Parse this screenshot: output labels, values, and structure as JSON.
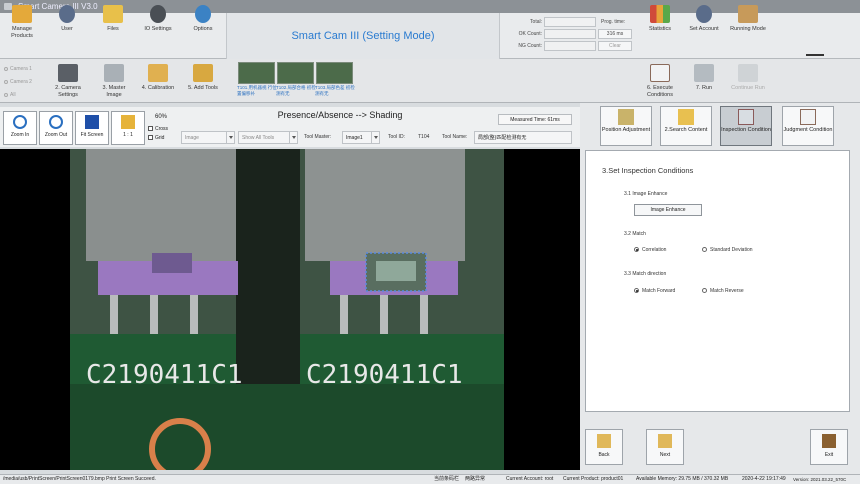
{
  "window": {
    "title": "Smart Camera III V3.0"
  },
  "ribbon": {
    "buttons": [
      {
        "label": "Manage Products"
      },
      {
        "label": "User"
      },
      {
        "label": "Files"
      },
      {
        "label": "IO Settings"
      },
      {
        "label": "Options"
      }
    ],
    "mode_title": "Smart Cam III (Setting Mode)",
    "counts": {
      "total_label": "Total:",
      "ok_label": "OK Count:",
      "ng_label": "NG Count:",
      "prog_time_label": "Prog. time:",
      "prog_time_value": "316 ms",
      "clear_label": "Clear"
    },
    "right_buttons": [
      {
        "label": "Statistics"
      },
      {
        "label": "Set Account"
      },
      {
        "label": "Running Mode"
      }
    ]
  },
  "cameras": [
    {
      "label": "Camera 1"
    },
    {
      "label": "Camera 2"
    },
    {
      "label": "All"
    }
  ],
  "steps": [
    {
      "label": "2. Camera Settings"
    },
    {
      "label": "3. Master Image"
    },
    {
      "label": "4. Calibration"
    },
    {
      "label": "5. Add Tools"
    },
    {
      "label": "6. Execute Conditions"
    },
    {
      "label": "7. Run"
    },
    {
      "label": "Continue Run"
    }
  ],
  "tool_thumbs": [
    {
      "caption": "T101.用机器视 行位置偏移补"
    },
    {
      "caption": "T102.局部合格 初检测有无"
    },
    {
      "caption": "T103.局部色差 初检测有无"
    }
  ],
  "toolbar": {
    "zoom_in": "Zoom In",
    "zoom_out": "Zoom Out",
    "fit_screen": "Fit Screen",
    "one_to_one": "1 : 1",
    "zoom_level": "60%",
    "cross": "Cross",
    "grid": "Grid",
    "page_title": "Presence/Absence --> Shading",
    "measured_time": "Measured Time: 61ms",
    "image_combo": "Image",
    "show_tools_combo": "Show All Tools",
    "tool_master_label": "Tool Master:",
    "tool_master_value": "Image1",
    "tool_id_label": "Tool ID:",
    "tool_id_value": "T104",
    "tool_name_label": "Tool Name:",
    "tool_name_value": "局部(整)匹配检测有无"
  },
  "image": {
    "left_text": "C2190411C1",
    "right_text": "C2190411C1"
  },
  "right_tabs": [
    {
      "label": "Position Adjustment"
    },
    {
      "label": "2.Search Content"
    },
    {
      "label": "Inspection Condition"
    },
    {
      "label": "Judgment Condition"
    }
  ],
  "inspection": {
    "title": "3.Set Inspection Conditions",
    "enhance_header": "3.1 Image Enhance",
    "enhance_button": "Image Enhance",
    "match_header": "3.2 Match",
    "match_opt1": "Correlation",
    "match_opt2": "Standard Deviation",
    "dir_header": "3.3 Match direction",
    "dir_opt1": "Match Forward",
    "dir_opt2": "Match Reverse"
  },
  "nav": {
    "back": "Back",
    "next": "Next",
    "exit": "Exit"
  },
  "status": {
    "path": "/media/usb/PrintScreen/PrintScreen0179.bmp Print Screen Succeed.",
    "s1": "当前条码栏",
    "s2": "两路异常",
    "account": "Current Account: root",
    "product": "Current Product: product01",
    "memory": "Available Memory: 29.75 MB / 370.32 MB",
    "datetime": "2020-4-22 19:17:49",
    "version": "Version: 2021.03.22_570C"
  }
}
